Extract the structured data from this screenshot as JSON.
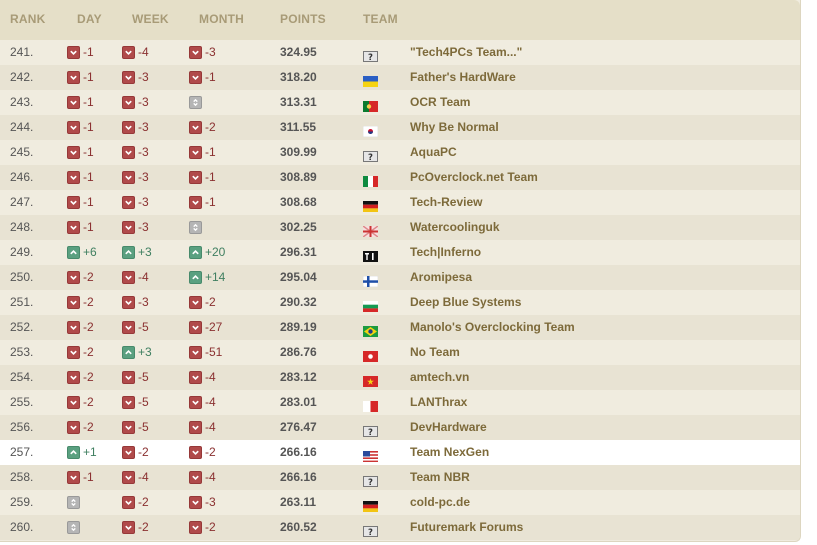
{
  "headers": {
    "rank": "RANK",
    "day": "DAY",
    "week": "WEEK",
    "month": "MONTH",
    "points": "POINTS",
    "team": "TEAM"
  },
  "rows": [
    {
      "rank": "241.",
      "day": {
        "dir": "down",
        "val": "-1"
      },
      "week": {
        "dir": "down",
        "val": "-4"
      },
      "month": {
        "dir": "down",
        "val": "-3"
      },
      "points": "324.95",
      "flag": "unknown",
      "team": "\"Tech4PCs Team...\""
    },
    {
      "rank": "242.",
      "day": {
        "dir": "down",
        "val": "-1"
      },
      "week": {
        "dir": "down",
        "val": "-3"
      },
      "month": {
        "dir": "down",
        "val": "-1"
      },
      "points": "318.20",
      "flag": "ukraine",
      "team": "Father's HardWare"
    },
    {
      "rank": "243.",
      "day": {
        "dir": "down",
        "val": "-1"
      },
      "week": {
        "dir": "down",
        "val": "-3"
      },
      "month": {
        "dir": "same",
        "val": ""
      },
      "points": "313.31",
      "flag": "portugal",
      "team": "OCR Team"
    },
    {
      "rank": "244.",
      "day": {
        "dir": "down",
        "val": "-1"
      },
      "week": {
        "dir": "down",
        "val": "-3"
      },
      "month": {
        "dir": "down",
        "val": "-2"
      },
      "points": "311.55",
      "flag": "south-korea",
      "team": "Why Be Normal"
    },
    {
      "rank": "245.",
      "day": {
        "dir": "down",
        "val": "-1"
      },
      "week": {
        "dir": "down",
        "val": "-3"
      },
      "month": {
        "dir": "down",
        "val": "-1"
      },
      "points": "309.99",
      "flag": "unknown",
      "team": "AquaPC"
    },
    {
      "rank": "246.",
      "day": {
        "dir": "down",
        "val": "-1"
      },
      "week": {
        "dir": "down",
        "val": "-3"
      },
      "month": {
        "dir": "down",
        "val": "-1"
      },
      "points": "308.89",
      "flag": "italy",
      "team": "PcOverclock.net Team"
    },
    {
      "rank": "247.",
      "day": {
        "dir": "down",
        "val": "-1"
      },
      "week": {
        "dir": "down",
        "val": "-3"
      },
      "month": {
        "dir": "down",
        "val": "-1"
      },
      "points": "308.68",
      "flag": "germany",
      "team": "Tech-Review"
    },
    {
      "rank": "248.",
      "day": {
        "dir": "down",
        "val": "-1"
      },
      "week": {
        "dir": "down",
        "val": "-3"
      },
      "month": {
        "dir": "same",
        "val": ""
      },
      "points": "302.25",
      "flag": "uk",
      "team": "Watercoolinguk"
    },
    {
      "rank": "249.",
      "day": {
        "dir": "up",
        "val": "+6"
      },
      "week": {
        "dir": "up",
        "val": "+3"
      },
      "month": {
        "dir": "up",
        "val": "+20"
      },
      "points": "296.31",
      "flag": "team-logo",
      "team": "Tech|Inferno"
    },
    {
      "rank": "250.",
      "day": {
        "dir": "down",
        "val": "-2"
      },
      "week": {
        "dir": "down",
        "val": "-4"
      },
      "month": {
        "dir": "up",
        "val": "+14"
      },
      "points": "295.04",
      "flag": "finland",
      "team": "Aromipesa"
    },
    {
      "rank": "251.",
      "day": {
        "dir": "down",
        "val": "-2"
      },
      "week": {
        "dir": "down",
        "val": "-3"
      },
      "month": {
        "dir": "down",
        "val": "-2"
      },
      "points": "290.32",
      "flag": "bulgaria",
      "team": "Deep Blue Systems"
    },
    {
      "rank": "252.",
      "day": {
        "dir": "down",
        "val": "-2"
      },
      "week": {
        "dir": "down",
        "val": "-5"
      },
      "month": {
        "dir": "down",
        "val": "-27"
      },
      "points": "289.19",
      "flag": "brazil",
      "team": "Manolo's Overclocking Team"
    },
    {
      "rank": "253.",
      "day": {
        "dir": "down",
        "val": "-2"
      },
      "week": {
        "dir": "up",
        "val": "+3"
      },
      "month": {
        "dir": "down",
        "val": "-51"
      },
      "points": "286.76",
      "flag": "hong-kong",
      "team": "No Team"
    },
    {
      "rank": "254.",
      "day": {
        "dir": "down",
        "val": "-2"
      },
      "week": {
        "dir": "down",
        "val": "-5"
      },
      "month": {
        "dir": "down",
        "val": "-4"
      },
      "points": "283.12",
      "flag": "vietnam",
      "team": "amtech.vn"
    },
    {
      "rank": "255.",
      "day": {
        "dir": "down",
        "val": "-2"
      },
      "week": {
        "dir": "down",
        "val": "-5"
      },
      "month": {
        "dir": "down",
        "val": "-4"
      },
      "points": "283.01",
      "flag": "malta",
      "team": "LANThrax"
    },
    {
      "rank": "256.",
      "day": {
        "dir": "down",
        "val": "-2"
      },
      "week": {
        "dir": "down",
        "val": "-5"
      },
      "month": {
        "dir": "down",
        "val": "-4"
      },
      "points": "276.47",
      "flag": "unknown",
      "team": "DevHardware"
    },
    {
      "rank": "257.",
      "day": {
        "dir": "up",
        "val": "+1"
      },
      "week": {
        "dir": "down",
        "val": "-2"
      },
      "month": {
        "dir": "down",
        "val": "-2"
      },
      "points": "266.16",
      "flag": "usa",
      "team": "Team NexGen",
      "highlight": true
    },
    {
      "rank": "258.",
      "day": {
        "dir": "down",
        "val": "-1"
      },
      "week": {
        "dir": "down",
        "val": "-4"
      },
      "month": {
        "dir": "down",
        "val": "-4"
      },
      "points": "266.16",
      "flag": "unknown",
      "team": "Team NBR"
    },
    {
      "rank": "259.",
      "day": {
        "dir": "same",
        "val": ""
      },
      "week": {
        "dir": "down",
        "val": "-2"
      },
      "month": {
        "dir": "down",
        "val": "-3"
      },
      "points": "263.11",
      "flag": "germany",
      "team": "cold-pc.de"
    },
    {
      "rank": "260.",
      "day": {
        "dir": "same",
        "val": ""
      },
      "week": {
        "dir": "down",
        "val": "-2"
      },
      "month": {
        "dir": "down",
        "val": "-2"
      },
      "points": "260.52",
      "flag": "unknown",
      "team": "Futuremark Forums"
    }
  ]
}
